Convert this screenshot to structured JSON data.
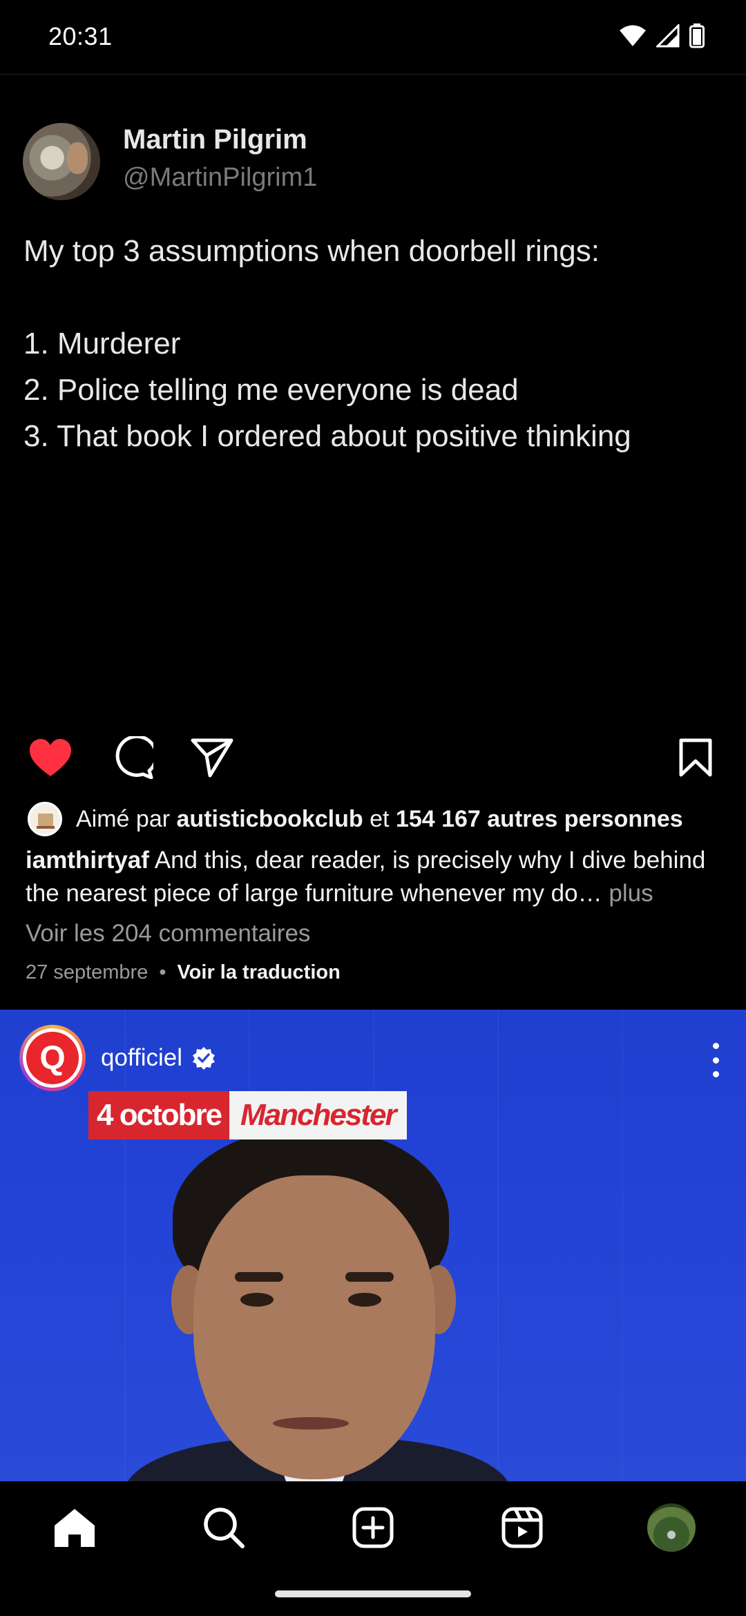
{
  "status_bar": {
    "time": "20:31"
  },
  "tweet": {
    "author_name": "Martin Pilgrim",
    "author_handle": "@MartinPilgrim1",
    "body": "My top 3 assumptions when doorbell rings:\n\n1. Murderer\n2. Police telling me everyone is dead\n3. That book I ordered about positive thinking"
  },
  "post_actions": {
    "like_icon": "heart-filled-icon",
    "comment_icon": "comment-bubble-icon",
    "share_icon": "paper-plane-icon",
    "save_icon": "bookmark-icon",
    "like_color": "#ff3040"
  },
  "likes": {
    "prefix": "Aimé par",
    "first_user": "autisticbookclub",
    "connector": "et",
    "others": "154 167 autres personnes"
  },
  "caption": {
    "username": "iamthirtyaf",
    "text": "And this, dear reader, is precisely why I dive behind the nearest piece of large furniture whenever my do…",
    "more": "plus"
  },
  "comments_link": "Voir les 204 commentaires",
  "post_date": "27 septembre",
  "translate_link": "Voir la traduction",
  "next_post": {
    "username": "qofficiel",
    "avatar_letter": "Q",
    "banner_date": "4 octobre",
    "banner_city": "Manchester",
    "verified_color": "#ffffff"
  },
  "bottom_nav": {
    "items": [
      "home-icon",
      "search-icon",
      "create-icon",
      "reels-icon",
      "profile-avatar"
    ]
  }
}
